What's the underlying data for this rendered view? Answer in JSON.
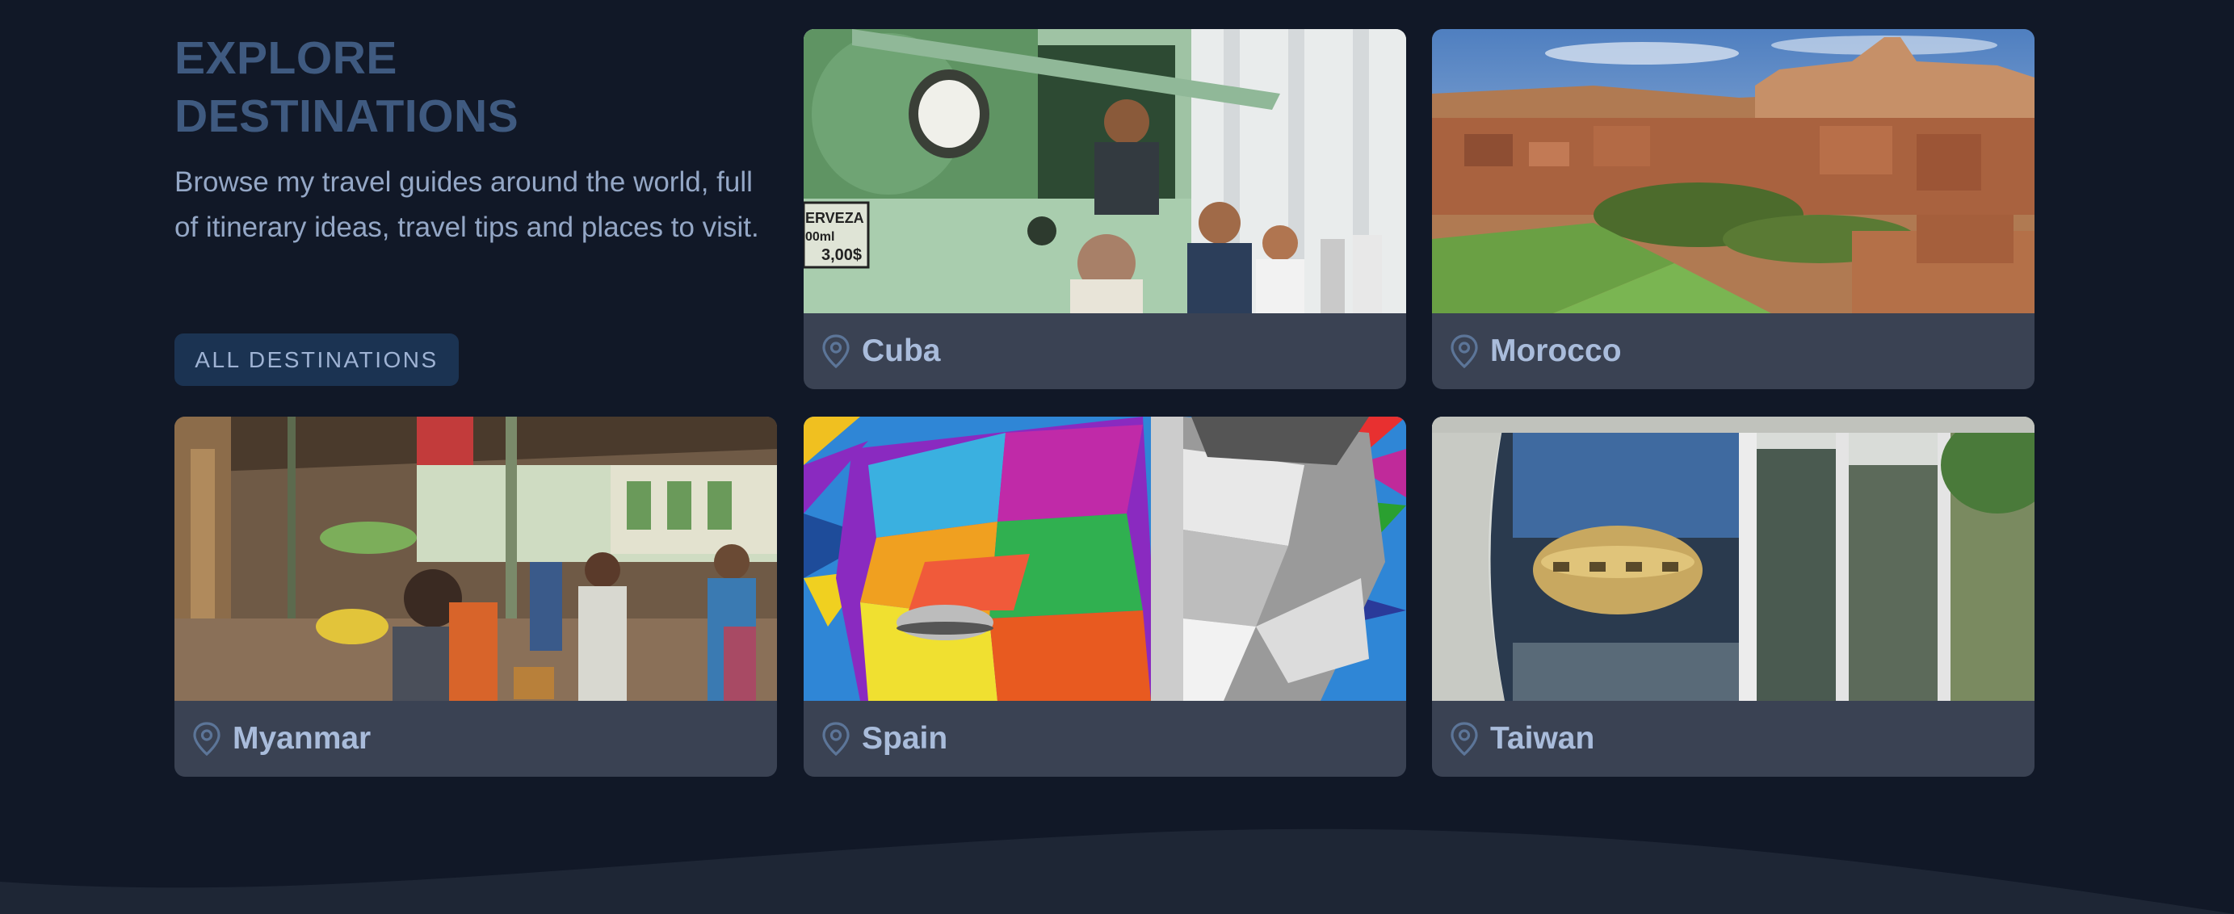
{
  "intro": {
    "title_line1": "EXPLORE",
    "title_line2": "DESTINATIONS",
    "description": "Browse my travel guides around the world, full of itinerary ideas, travel tips and places to visit.",
    "button_label": "ALL DESTINATIONS"
  },
  "destinations": [
    {
      "name": "Cuba",
      "photo": "cuba-street-vendor-photo"
    },
    {
      "name": "Morocco",
      "photo": "morocco-kasbah-village-photo"
    },
    {
      "name": "Myanmar",
      "photo": "myanmar-market-photo"
    },
    {
      "name": "Spain",
      "photo": "spain-geometric-mural-photo"
    },
    {
      "name": "Taiwan",
      "photo": "taiwan-futuro-house-photo"
    }
  ],
  "photo_signs": {
    "cuba_sign_line1": "ERVEZA",
    "cuba_sign_line2": "00ml",
    "cuba_sign_line3": "3,00$"
  },
  "colors": {
    "background": "#111827",
    "card_bar": "#3a4253",
    "title": "#3f5a80",
    "label": "#a9bcdb",
    "button_bg": "#1b3352",
    "wave": "#1e2635"
  },
  "icons": {
    "location": "map-pin-icon"
  }
}
